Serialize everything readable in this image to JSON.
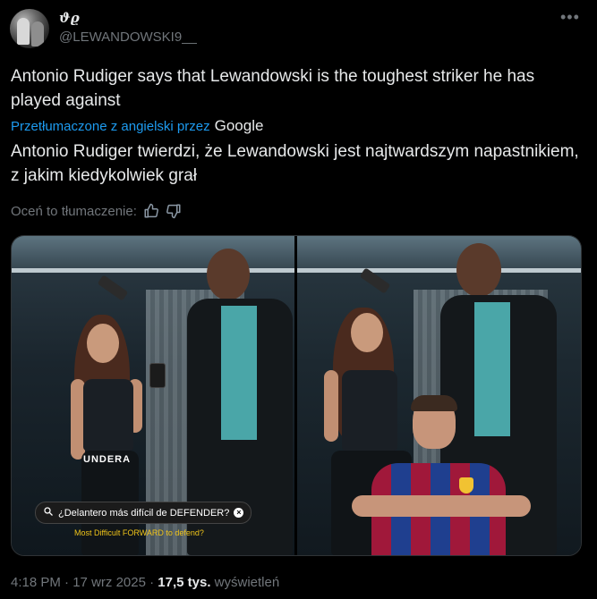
{
  "tweet": {
    "display_name": "ϑϱ",
    "handle": "@LEWANDOWSKI9__",
    "more_icon": "more-dots-icon",
    "text_original": "Antonio Rudiger says that Lewandowski is the toughest striker he has played against",
    "translated_label": "Przetłumaczone z angielski przez",
    "translated_provider": "Google",
    "text_translated": "Antonio Rudiger twierdzi, że Lewandowski jest najtwardszym napastnikiem, z jakim kiedykolwiek grał",
    "rate_label": "Oceń to tłumaczenie:",
    "media": {
      "caption_question": "¿Delantero más difícil de DEFENDER?",
      "caption_subtitle": "Most Difficult FORWARD to defend?",
      "shirt_text": "UNDERA"
    },
    "time": "4:18 PM",
    "date": "17 wrz 2025",
    "separator": "·",
    "views_count": "17,5 tys.",
    "views_label": "wyświetleń"
  }
}
